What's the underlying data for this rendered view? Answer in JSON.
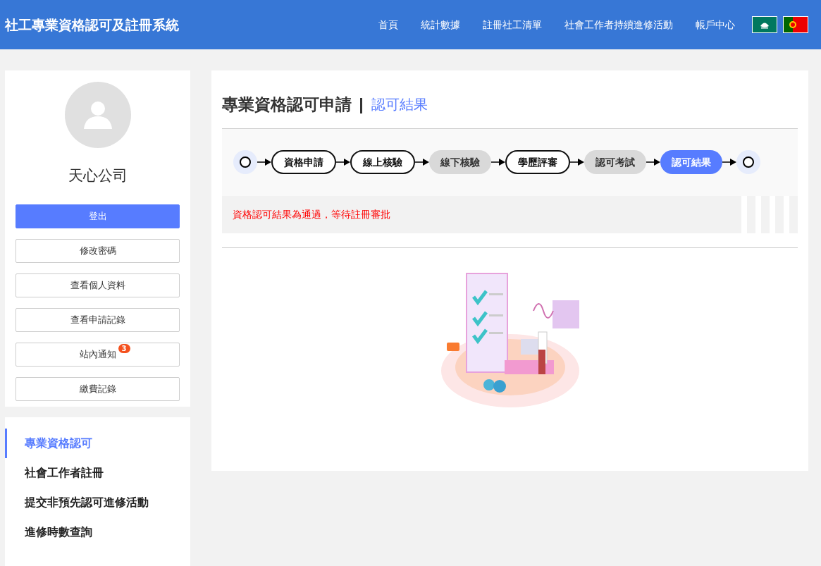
{
  "navbar": {
    "brand": "社工專業資格認可及註冊系統",
    "links": [
      "首頁",
      "統計數據",
      "註冊社工清單",
      "社會工作者持續進修活動",
      "帳戶中心"
    ]
  },
  "profile": {
    "name": "天心公司",
    "logout": "登出",
    "buttons": [
      {
        "label": "修改密碼"
      },
      {
        "label": "查看個人資料"
      },
      {
        "label": "查看申請記錄"
      },
      {
        "label": "站內通知",
        "badge": "3"
      },
      {
        "label": "繳費記錄"
      }
    ]
  },
  "menu": [
    {
      "label": "專業資格認可",
      "selected": true
    },
    {
      "label": "社會工作者註冊",
      "selected": false
    },
    {
      "label": "提交非預先認可進修活動",
      "selected": false
    },
    {
      "label": "進修時數查詢",
      "selected": false
    }
  ],
  "page": {
    "title": "專業資格認可申請",
    "subtitle": "認可結果"
  },
  "steps": [
    {
      "label": "資格申請",
      "kind": "done"
    },
    {
      "label": "線上核驗",
      "kind": "done"
    },
    {
      "label": "線下核驗",
      "kind": "skipped"
    },
    {
      "label": "學歷評審",
      "kind": "done"
    },
    {
      "label": "認可考試",
      "kind": "skipped"
    },
    {
      "label": "認可結果",
      "kind": "current"
    }
  ],
  "message": "資格認可結果為通過，等待註冊審批"
}
